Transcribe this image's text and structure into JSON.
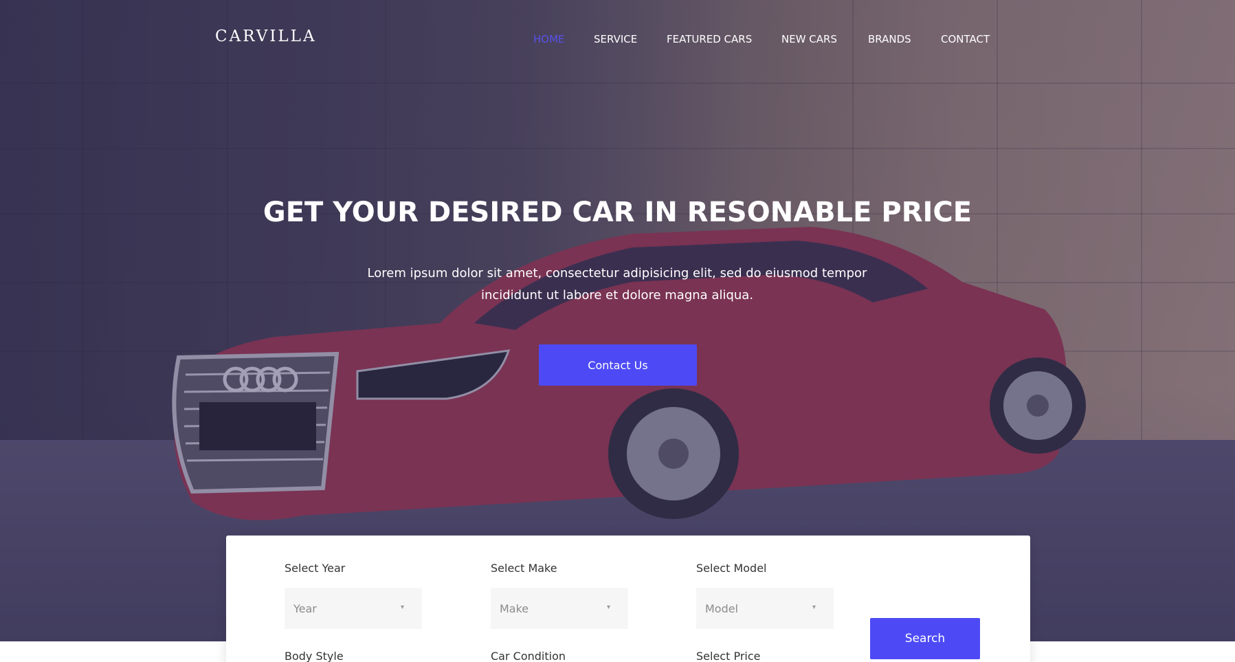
{
  "brand": {
    "logo": "CARVILLA"
  },
  "nav": {
    "items": [
      {
        "label": "HOME",
        "active": true
      },
      {
        "label": "SERVICE"
      },
      {
        "label": "FEATURED CARS"
      },
      {
        "label": "NEW CARS"
      },
      {
        "label": "BRANDS"
      },
      {
        "label": "CONTACT"
      }
    ]
  },
  "hero": {
    "headline": "GET YOUR DESIRED CAR IN RESONABLE PRICE",
    "subtext_line1": "Lorem ipsum dolor sit amet, consectetur adipisicing elit, sed do eiusmod tempor",
    "subtext_line2": "incididunt ut labore et dolore magna aliqua.",
    "cta_label": "Contact Us"
  },
  "search": {
    "fields": [
      {
        "label": "Select Year",
        "value": "Year"
      },
      {
        "label": "Select Make",
        "value": "Make"
      },
      {
        "label": "Select Model",
        "value": "Model"
      }
    ],
    "row2_labels": [
      "Body Style",
      "Car Condition",
      "Select Price"
    ],
    "button_label": "Search"
  },
  "colors": {
    "accent": "#4d4af5",
    "nav_active": "#5851e8",
    "panel_bg": "#ffffff",
    "select_bg": "#f6f6f6"
  }
}
